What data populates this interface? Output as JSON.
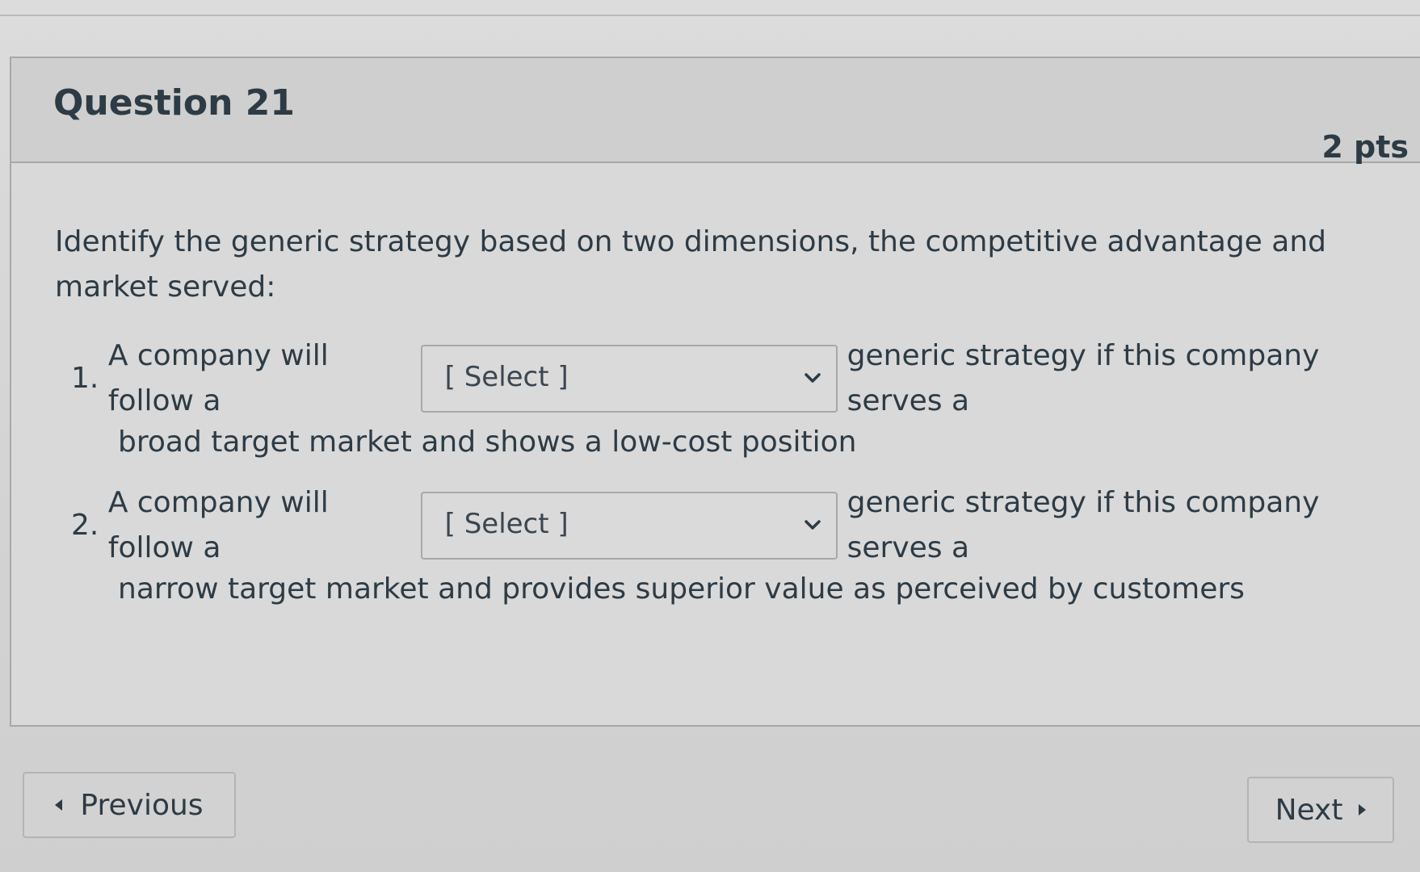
{
  "question": {
    "title": "Question 21",
    "points": "2 pts",
    "prompt": "Identify the generic strategy based on two dimensions, the competitive advantage and market served:"
  },
  "items": [
    {
      "number": "1.",
      "prefix": "A company will follow a",
      "select_value": "[ Select ]",
      "suffix": "generic strategy if this company serves a",
      "continuation": "broad target market and shows a low-cost position"
    },
    {
      "number": "2.",
      "prefix": "A company will follow a",
      "select_value": "[ Select ]",
      "suffix": "generic strategy if this company serves a",
      "continuation": "narrow target market and provides superior value as perceived by customers"
    }
  ],
  "navigation": {
    "previous_label": "Previous",
    "next_label": "Next"
  },
  "icons": {
    "dropdown": "chevron-down-icon",
    "previous": "triangle-left-icon",
    "next": "triangle-right-icon"
  }
}
